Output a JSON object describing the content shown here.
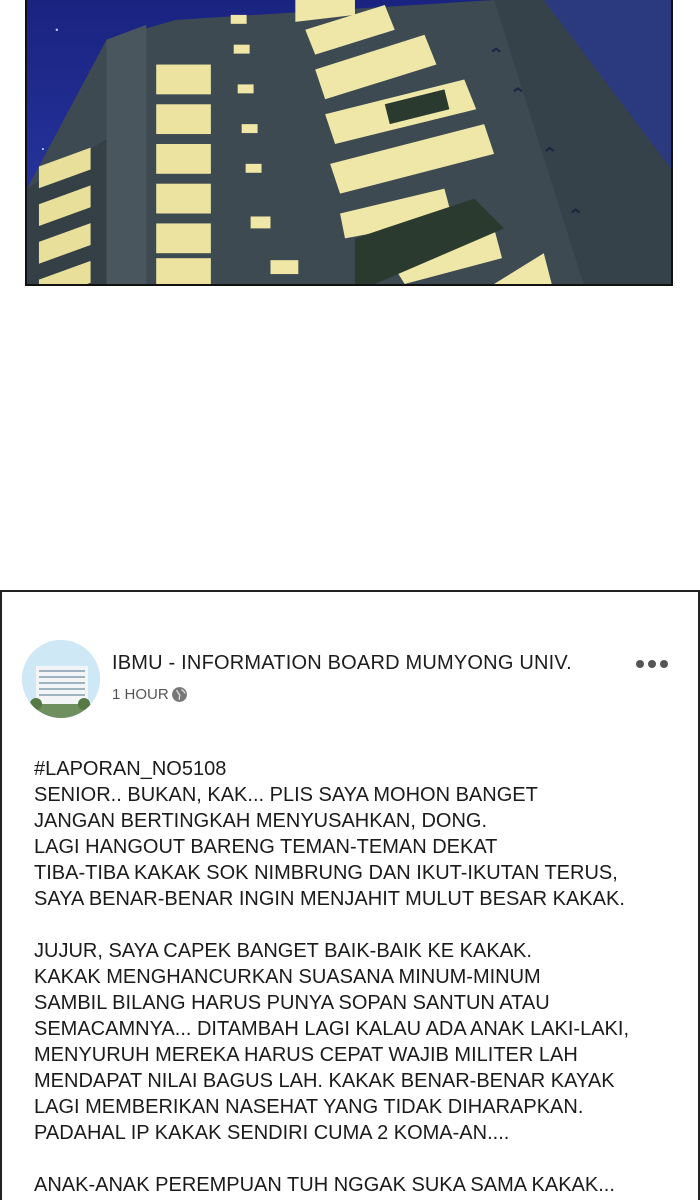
{
  "post": {
    "page_name": "IBMU - INFORMATION BOARD MUMYONG UNIV.",
    "time": "1 HOUR",
    "paragraphs": [
      "#LAPORAN_NO5108\nSENIOR.. BUKAN, KAK... PLIS SAYA MOHON BANGET\nJANGAN BERTINGKAH MENYUSAHKAN, DONG.\nLAGI HANGOUT BARENG TEMAN-TEMAN DEKAT\nTIBA-TIBA KAKAK SOK NIMBRUNG DAN IKUT-IKUTAN TERUS,\nSAYA BENAR-BENAR INGIN MENJAHIT MULUT BESAR KAKAK.",
      "JUJUR, SAYA CAPEK BANGET BAIK-BAIK KE KAKAK.\nKAKAK MENGHANCURKAN SUASANA MINUM-MINUM\nSAMBIL BILANG HARUS PUNYA SOPAN SANTUN ATAU\nSEMACAMNYA... DITAMBAH LAGI KALAU ADA ANAK LAKI-LAKI,\nMENYURUH MEREKA HARUS CEPAT WAJIB MILITER LAH\nMENDAPAT NILAI BAGUS LAH. KAKAK BENAR-BENAR KAYAK\nLAGI MEMBERIKAN NASEHAT YANG TIDAK DIHARAPKAN.\nPADAHAL IP KAKAK SENDIRI CUMA 2 KOMA-AN....",
      "ANAK-ANAK PEREMPUAN TUH NGGAK SUKA SAMA KAKAK..."
    ]
  },
  "icons": {
    "privacy": "globe-icon",
    "menu": "more-dots-icon"
  },
  "colors": {
    "sky": "#1c2a8e",
    "building": "#3e4b52",
    "window_light": "#efe9a6"
  }
}
